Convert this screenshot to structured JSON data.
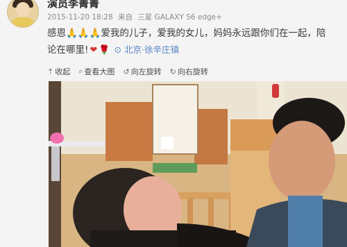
{
  "post": {
    "username": "演员李菁菁",
    "timestamp": "2015-11-20 18:28",
    "source_prefix": "来自",
    "source_device": "三星 GALAXY S6 edge+",
    "text_line1": "感恩🙏🙏🙏爱我的儿子，爱我的女儿，妈妈永远跟你们在一起，陪",
    "text_line2": "论在哪里!",
    "heart": "❤",
    "rose": "🌹",
    "location": "北京·徐辛庄镇"
  },
  "toolbar": {
    "collapse": "收起",
    "view_large": "查看大图",
    "rotate_left": "向左旋转",
    "rotate_right": "向右旋转"
  },
  "icons": {
    "collapse": "collapse-icon",
    "view_large": "magnifier-icon",
    "rotate_left": "rotate-left-icon",
    "rotate_right": "rotate-right-icon",
    "location": "location-pin-icon"
  },
  "colors": {
    "location_link": "#5b86c5",
    "heart": "#d63a3a"
  }
}
